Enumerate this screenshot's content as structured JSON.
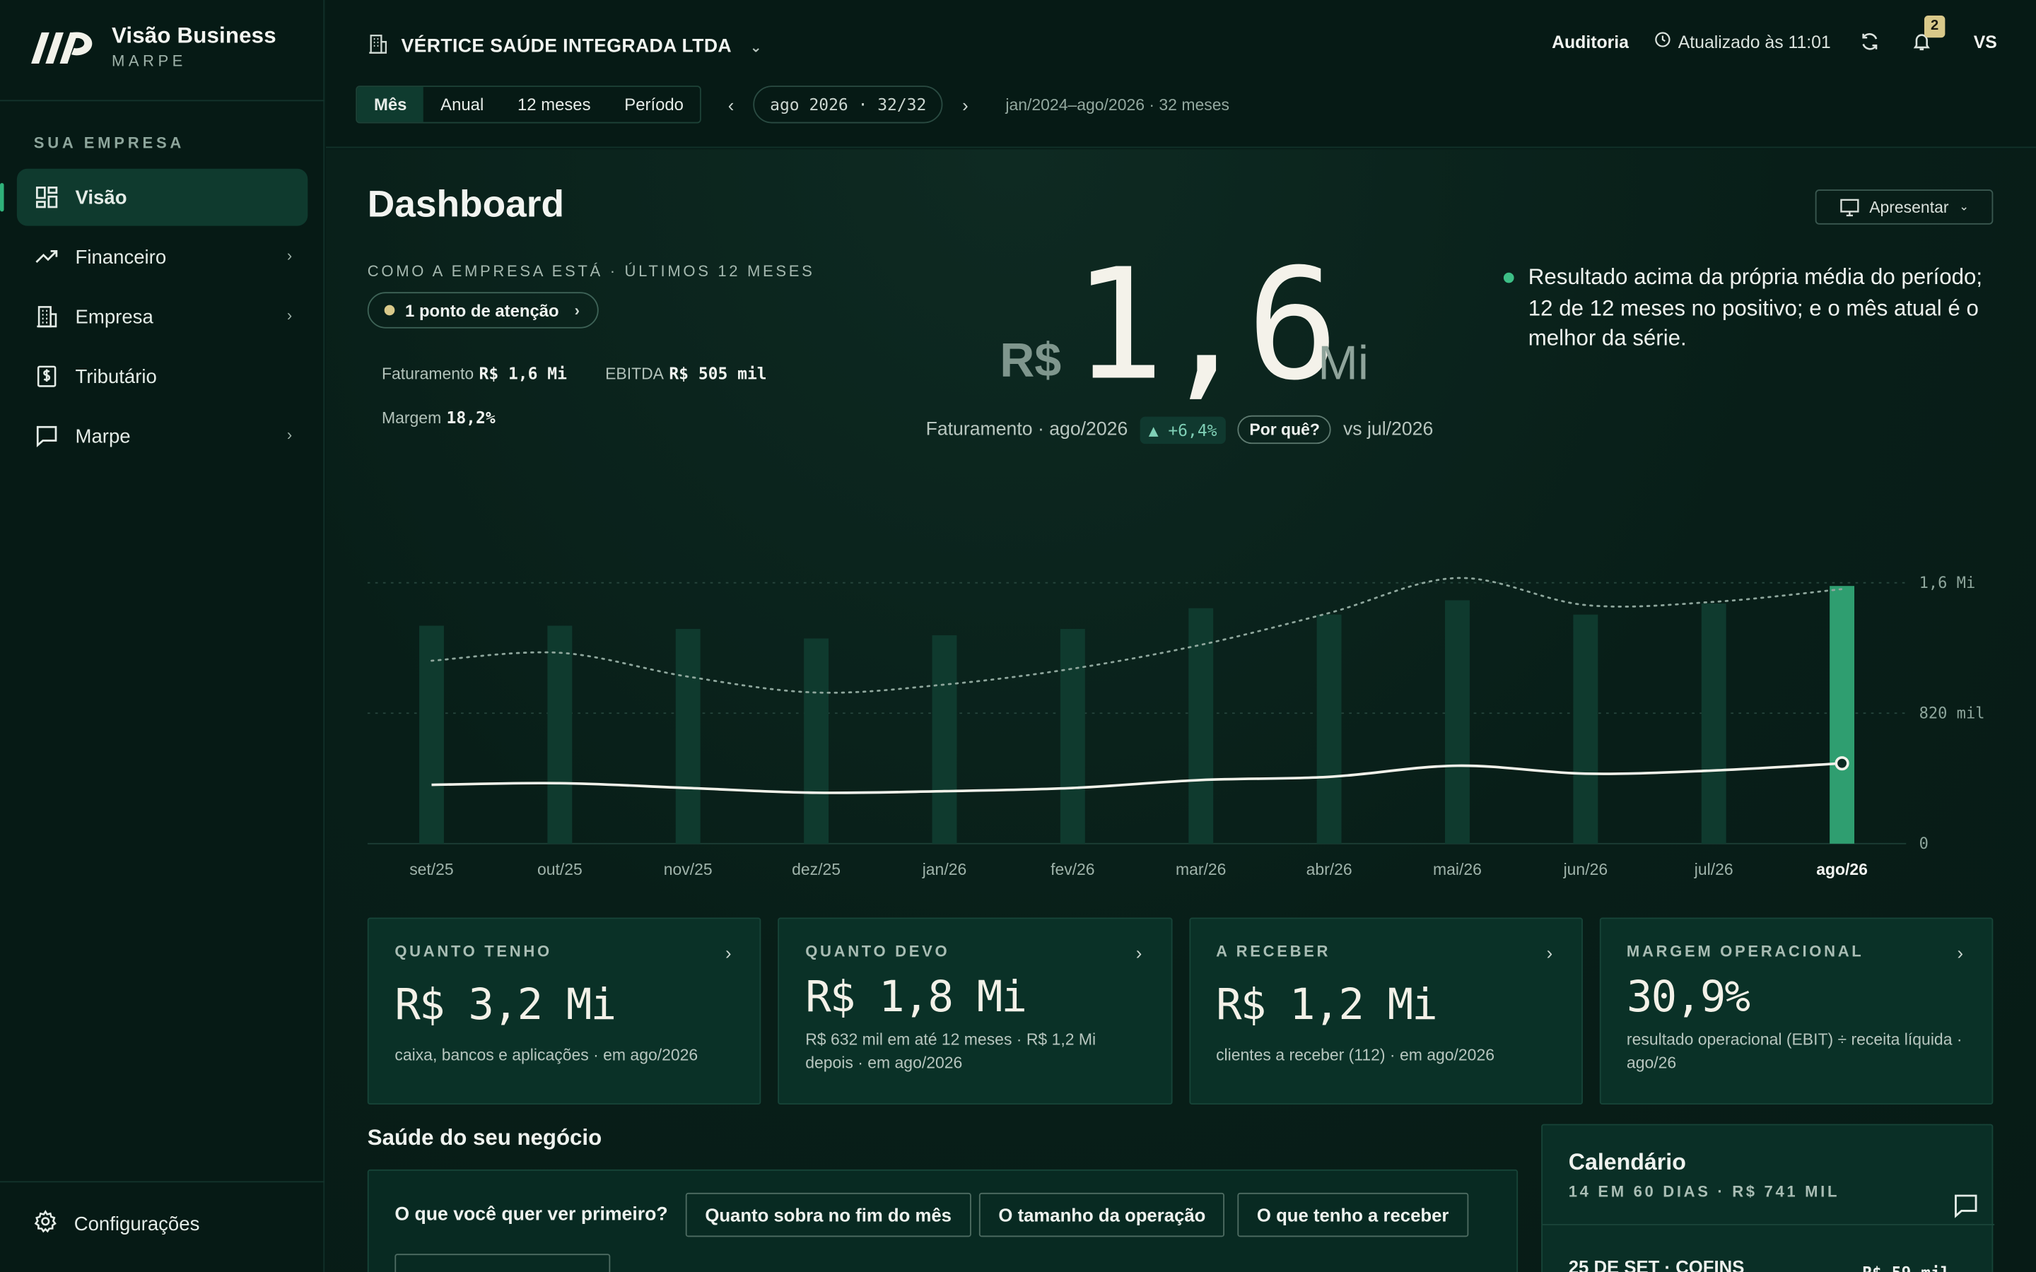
{
  "brand": {
    "title": "Visão Business",
    "subtitle": "MARPE"
  },
  "sidebar": {
    "section_label": "SUA EMPRESA",
    "items": [
      {
        "label": "Visão",
        "icon": "dashboard-icon",
        "active": true,
        "chevron": false
      },
      {
        "label": "Financeiro",
        "icon": "trending-up-icon",
        "active": false,
        "chevron": true
      },
      {
        "label": "Empresa",
        "icon": "building-icon",
        "active": false,
        "chevron": true
      },
      {
        "label": "Tributário",
        "icon": "receipt-icon",
        "active": false,
        "chevron": false
      },
      {
        "label": "Marpe",
        "icon": "chat-icon",
        "active": false,
        "chevron": true
      }
    ],
    "settings_label": "Configurações"
  },
  "topbar": {
    "company": "VÉRTICE SAÚDE INTEGRADA LTDA",
    "tabs": [
      {
        "label": "Mês",
        "active": true
      },
      {
        "label": "Anual",
        "active": false
      },
      {
        "label": "12 meses",
        "active": false
      },
      {
        "label": "Período",
        "active": false
      }
    ],
    "period": "ago 2026 · 32/32",
    "range": "jan/2024–ago/2026 · 32 meses",
    "audit": "Auditoria",
    "updated": "Atualizado às 11:01",
    "notifications": "2",
    "avatar": "VS"
  },
  "dashboard": {
    "title": "Dashboard",
    "present_label": "Apresentar",
    "overview_label": "COMO A EMPRESA ESTÁ · ÚLTIMOS 12 MESES",
    "attention_label": "1 ponto de atenção",
    "mini": {
      "faturamento_label": "Faturamento",
      "faturamento_value": "R$ 1,6 Mi",
      "ebitda_label": "EBITDA",
      "ebitda_value": "R$ 505 mil",
      "margem_label": "Margem",
      "margem_value": "18,2%"
    },
    "hero": {
      "currency": "R$",
      "value": "1,6",
      "unit": "Mi",
      "caption": "Faturamento · ago/2026",
      "delta": "▲ +6,4%",
      "why": "Por quê?",
      "compare": "vs jul/2026"
    },
    "insight": "Resultado acima da própria média do período; 12 de 12 meses no positivo; e o mês atual é o melhor da série."
  },
  "chart_data": {
    "type": "bar",
    "categories": [
      "set/25",
      "out/25",
      "nov/25",
      "dez/25",
      "jan/26",
      "fev/26",
      "mar/26",
      "abr/26",
      "mai/26",
      "jun/26",
      "jul/26",
      "ago/26"
    ],
    "series": [
      {
        "values": [
          1.37,
          1.37,
          1.35,
          1.29,
          1.31,
          1.35,
          1.48,
          1.44,
          1.53,
          1.44,
          1.51,
          1.62
        ]
      },
      {
        "values": [
          1.15,
          1.2,
          1.05,
          0.95,
          1.0,
          1.1,
          1.25,
          1.45,
          1.67,
          1.5,
          1.52,
          1.6
        ]
      },
      {
        "values": [
          0.37,
          0.38,
          0.35,
          0.32,
          0.33,
          0.35,
          0.4,
          0.42,
          0.49,
          0.44,
          0.46,
          0.505
        ]
      }
    ],
    "y_tick_labels": [
      "0",
      "820 mil",
      "1,6 Mi"
    ],
    "ylim": [
      0,
      1.64
    ],
    "highlight_index": 11,
    "colors": {
      "bar": "#0f3a2e",
      "bar_highlight": "#2f9e70",
      "line": "#f2f2ea",
      "dotted": "#8fa79d"
    }
  },
  "kpis": [
    {
      "label": "QUANTO TENHO",
      "value": "R$ 3,2 Mi",
      "desc": "caixa, bancos e aplicações · em ago/2026"
    },
    {
      "label": "QUANTO DEVO",
      "value": "R$ 1,8 Mi",
      "desc": "R$ 632 mil em até 12 meses · R$ 1,2 Mi depois · em ago/2026"
    },
    {
      "label": "A RECEBER",
      "value": "R$ 1,2 Mi",
      "desc": "clientes a receber (112) · em ago/2026"
    },
    {
      "label": "MARGEM OPERACIONAL",
      "value": "30,9%",
      "desc": "resultado operacional (EBIT) ÷ receita líquida · ago/26"
    }
  ],
  "health": {
    "title": "Saúde do seu negócio",
    "question": "O que você quer ver primeiro?",
    "chips": [
      "Quanto sobra no fim do mês",
      "O tamanho da operação",
      "O que tenho a receber"
    ]
  },
  "calendar": {
    "title": "Calendário",
    "subtitle": "14 EM 60 DIAS · R$ 741 MIL",
    "row_label": "25 DE SET · COFINS",
    "row_value": "R$ 59 mil"
  }
}
